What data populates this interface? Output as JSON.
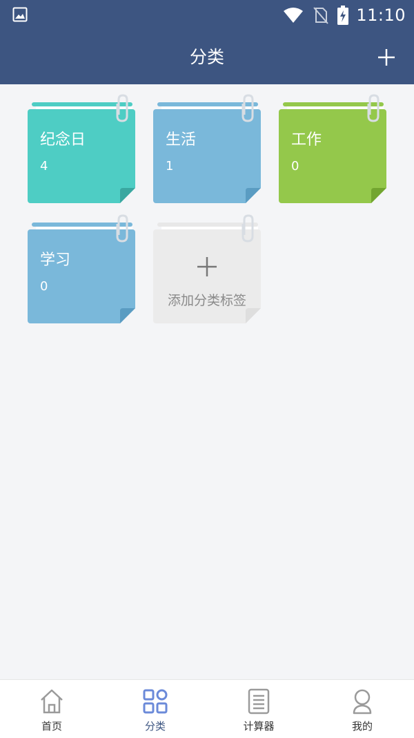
{
  "status_bar": {
    "time": "11:10"
  },
  "header": {
    "title": "分类"
  },
  "categories": [
    {
      "name": "纪念日",
      "count": "4",
      "color": "#4ecdc4",
      "fold": "#3aa7a0",
      "strip": "#4ecdc4"
    },
    {
      "name": "生活",
      "count": "1",
      "color": "#7ab8da",
      "fold": "#5a9cc2",
      "strip": "#7ab8da"
    },
    {
      "name": "工作",
      "count": "0",
      "color": "#94c84b",
      "fold": "#72a530",
      "strip": "#94c84b"
    },
    {
      "name": "学习",
      "count": "0",
      "color": "#7ab8da",
      "fold": "#5a9cc2",
      "strip": "#7ab8da"
    }
  ],
  "add_card": {
    "label": "添加分类标签"
  },
  "tabs": [
    {
      "label": "首页",
      "icon": "home-icon"
    },
    {
      "label": "分类",
      "icon": "category-grid-icon"
    },
    {
      "label": "计算器",
      "icon": "document-list-icon"
    },
    {
      "label": "我的",
      "icon": "user-icon"
    }
  ],
  "colors": {
    "header": "#3d5581",
    "background": "#f4f5f7",
    "tab_active": "#6b8ad9",
    "tab_inactive": "#9a9a9a"
  }
}
